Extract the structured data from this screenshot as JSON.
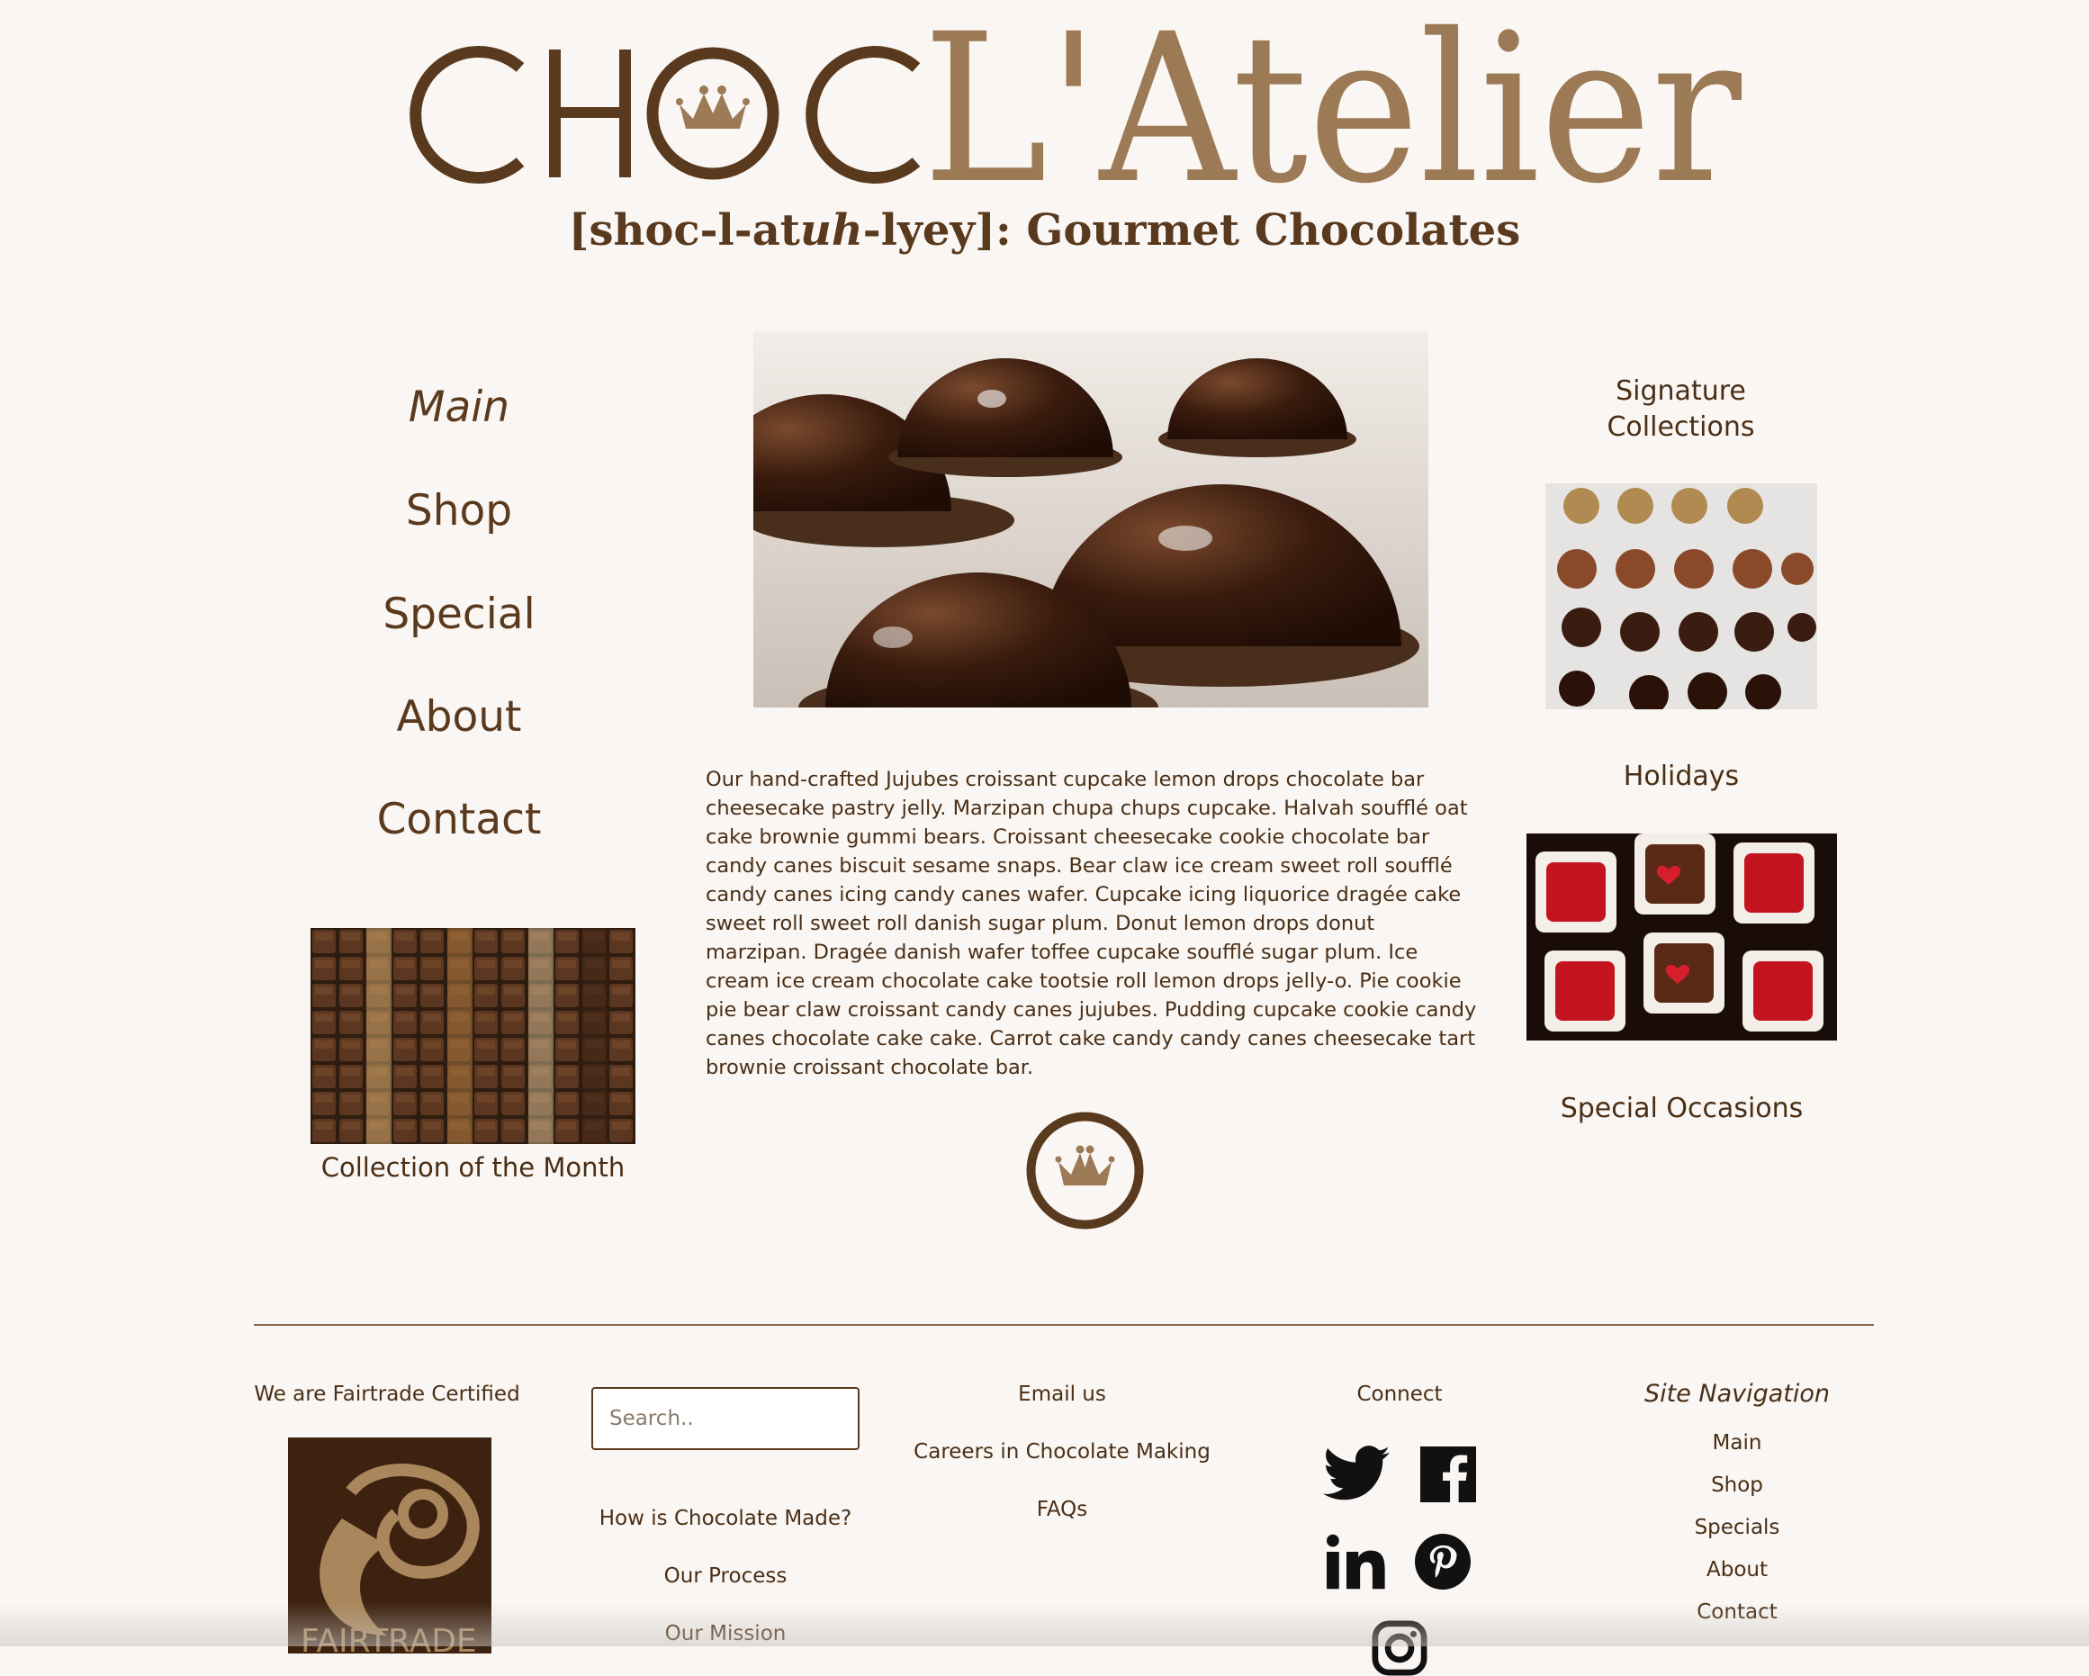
{
  "brand": {
    "logo_text_left": "CHOC",
    "logo_text_right": "L'Atelier",
    "tagline_start": "[shoc-l-at",
    "tagline_em": "uh",
    "tagline_end": "-lyey]: Gourmet Chocolates",
    "colors": {
      "dark": "#5a3a1e",
      "light": "#9c7a55"
    }
  },
  "nav": {
    "items": [
      {
        "label": "Main",
        "active": true
      },
      {
        "label": "Shop"
      },
      {
        "label": "Special"
      },
      {
        "label": "About"
      },
      {
        "label": "Contact"
      }
    ]
  },
  "feature": {
    "collection_caption": "Collection of the Month",
    "description": "Our hand-crafted Jujubes croissant cupcake lemon drops chocolate bar cheesecake pastry jelly. Marzipan chupa chups cupcake. Halvah soufflé oat cake brownie gummi bears. Croissant cheesecake cookie chocolate bar candy canes biscuit sesame snaps. Bear claw ice cream sweet roll soufflé candy canes icing candy canes wafer. Cupcake icing liquorice dragée cake sweet roll sweet roll danish sugar plum. Donut lemon drops donut marzipan. Dragée danish wafer toffee cupcake soufflé sugar plum. Ice cream ice cream chocolate cake tootsie roll lemon drops jelly-o. Pie cookie pie bear claw croissant candy canes jujubes. Pudding cupcake cookie candy canes chocolate cake cake. Carrot cake candy candy canes cheesecake tart brownie croissant chocolate bar."
  },
  "right": {
    "signature_line1": "Signature",
    "signature_line2": "Collections",
    "holidays": "Holidays",
    "special_occasions": "Special Occasions"
  },
  "footer": {
    "fairtrade_label": "We are Fairtrade Certified",
    "fairtrade_badge_text": "FAIRTRADE",
    "search_placeholder": "Search..",
    "how_made": "How is Chocolate Made?",
    "our_process": "Our Process",
    "our_mission": "Our Mission",
    "email_us": "Email us",
    "careers": "Careers in Chocolate Making",
    "faqs": "FAQs",
    "connect": "Connect",
    "site_nav_title": "Site Navigation",
    "site_nav": [
      "Main",
      "Shop",
      "Specials",
      "About",
      "Contact"
    ],
    "social_icons": [
      "twitter-icon",
      "facebook-icon",
      "linkedin-icon",
      "pinterest-icon",
      "instagram-icon"
    ]
  }
}
